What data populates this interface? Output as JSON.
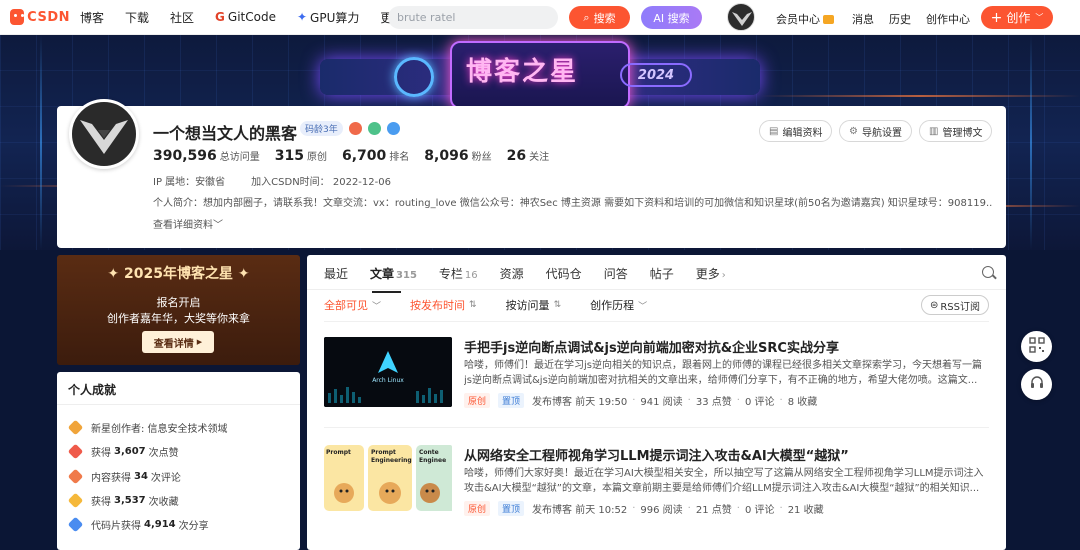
{
  "topbar": {
    "logo_text": "CSDN",
    "nav": [
      "博客",
      "下载",
      "社区",
      "GitCode",
      "GPU算力",
      "更多"
    ],
    "search_placeholder": "brute ratel",
    "search_button": "搜索",
    "ai_button": "AI 搜索",
    "right": [
      "会员中心",
      "消息",
      "历史",
      "创作中心"
    ],
    "create_button": "创作"
  },
  "banner": {
    "title": "博客之星",
    "year": "2024"
  },
  "profile": {
    "name": "一个想当文人的黑客",
    "code_age": "码龄3年",
    "stats": [
      {
        "value": "390,596",
        "label": "总访问量"
      },
      {
        "value": "315",
        "label": "原创"
      },
      {
        "value": "6,700",
        "label": "排名"
      },
      {
        "value": "8,096",
        "label": "粉丝"
      },
      {
        "value": "26",
        "label": "关注"
      }
    ],
    "ip": "IP 属地：安徽省",
    "joined": "加入CSDN时间：  2022-12-06",
    "bio": "个人简介：想加内部圈子，请联系我！文章交流：vx：routing_love 微信公众号：神农Sec 博主资源 需要如下资料和培训的可加微信和知识星球(前50名为邀请嘉宾) 知识星球号：908119...",
    "more_info": "查看详细资料",
    "buttons": [
      "编辑资料",
      "导航设置",
      "管理博文"
    ]
  },
  "promo": {
    "title": "2025年博客之星",
    "line1": "报名开启",
    "line2": "创作者嘉年华，大奖等你来拿",
    "button": "查看详情"
  },
  "achievements": {
    "title": "个人成就",
    "items": [
      {
        "pre": "新星创作者: 信息安全技术领域",
        "value": "",
        "post": "",
        "color": "#f0a43a"
      },
      {
        "pre": "获得",
        "value": "3,607",
        "post": "次点赞",
        "color": "#ef5a4a"
      },
      {
        "pre": "内容获得",
        "value": "34",
        "post": "次评论",
        "color": "#f07a4a"
      },
      {
        "pre": "获得",
        "value": "3,537",
        "post": "次收藏",
        "color": "#f5b83a"
      },
      {
        "pre": "代码片获得",
        "value": "4,914",
        "post": "次分享",
        "color": "#4a8cf0"
      }
    ]
  },
  "tabs": [
    {
      "label": "最近",
      "count": ""
    },
    {
      "label": "文章",
      "count": "315"
    },
    {
      "label": "专栏",
      "count": "16"
    },
    {
      "label": "资源",
      "count": ""
    },
    {
      "label": "代码仓",
      "count": ""
    },
    {
      "label": "问答",
      "count": ""
    },
    {
      "label": "帖子",
      "count": ""
    },
    {
      "label": "更多",
      "count": ""
    }
  ],
  "filters": [
    {
      "label": "全部可见",
      "suffix": "﹀"
    },
    {
      "label": "按发布时间",
      "suffix": "⇅"
    },
    {
      "label": "按访问量",
      "suffix": "⇅"
    },
    {
      "label": "创作历程",
      "suffix": "﹀"
    }
  ],
  "rss": "RSS订阅",
  "articles": [
    {
      "title": "手把手js逆向断点调试&js逆向前端加密对抗&企业SRC实战分享",
      "desc": "哈喽，师傅们！最近在学习js逆向相关的知识点，跟着网上的师傅的课程已经很多相关文章探索学习，今天想着写一篇js逆向断点调试&js逆向前端加密对抗相关的文章出来，给师傅们分享下，有不正确的地方，希望大佬勿喷。这篇文...",
      "tag1": "原创",
      "tag2": "置顶",
      "time": "发布博客 前天 19:50",
      "reads": "941 阅读",
      "likes": "33 点赞",
      "comments": "0 评论",
      "favs": "8 收藏",
      "thumb_text": "Arch Linux"
    },
    {
      "title": "从网络安全工程师视角学习LLM提示词注入攻击&AI大模型“越狱”",
      "desc": "哈喽，师傅们大家好奥！最近在学习AI大模型相关安全，所以抽空写了这篇从网络安全工程师视角学习LLM提示词注入攻击&AI大模型“越狱”的文章，本篇文章前期主要是给师傅们介绍LLM提示词注入攻击&AI大模型“越狱”的相关知识...",
      "tag1": "原创",
      "tag2": "置顶",
      "time": "发布博客 前天 10:52",
      "reads": "996 阅读",
      "likes": "21 点赞",
      "comments": "0 评论",
      "favs": "21 收藏",
      "thumb_labels": [
        "Prompt",
        "Prompt Engineering",
        "Conte Enginee"
      ]
    }
  ]
}
